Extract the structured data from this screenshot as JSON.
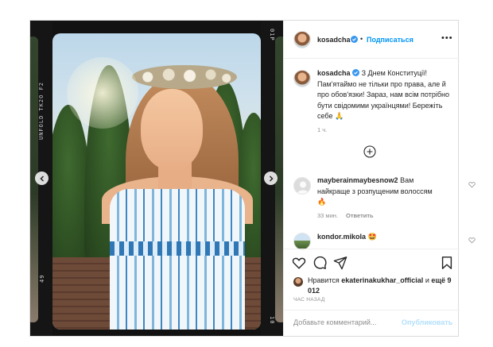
{
  "header": {
    "username": "kosadcha",
    "follow_label": "Подписаться",
    "separator": "•",
    "more": "•••"
  },
  "media": {
    "film_text_left": "UNFOLD TK2O F2",
    "film_number_left": "49",
    "film_number_right_top": "01P",
    "film_number_right_bottom": "10"
  },
  "caption": {
    "username": "kosadcha",
    "text": "З Днем Конституції! Пам'ятаймо не тільки про права, але й про обов'язки! Зараз, нам всім потрібно бути свідомими українцями! Бережіть себе 🙏",
    "time": "1 ч."
  },
  "comments": [
    {
      "username": "mayberainmaybesnow2",
      "text": "Вам найкраще з розпущеним волоссям🔥",
      "time": "33 мин.",
      "reply_label": "Ответить"
    },
    {
      "username": "kondor.mikola",
      "text": "🤩"
    }
  ],
  "likes": {
    "prefix": "Нравится",
    "user": "ekaterinakukhar_official",
    "suffix": "и",
    "others": "ещё 9 012"
  },
  "posted": "ЧАС НАЗАД",
  "comment_box": {
    "placeholder": "Добавьте комментарий...",
    "publish_label": "Опубликовать"
  },
  "colors": {
    "link_blue": "#0095f6",
    "publish_disabled": "#b2dffc",
    "verified_blue": "#3897f0",
    "muted_text": "#8e8e8e"
  }
}
